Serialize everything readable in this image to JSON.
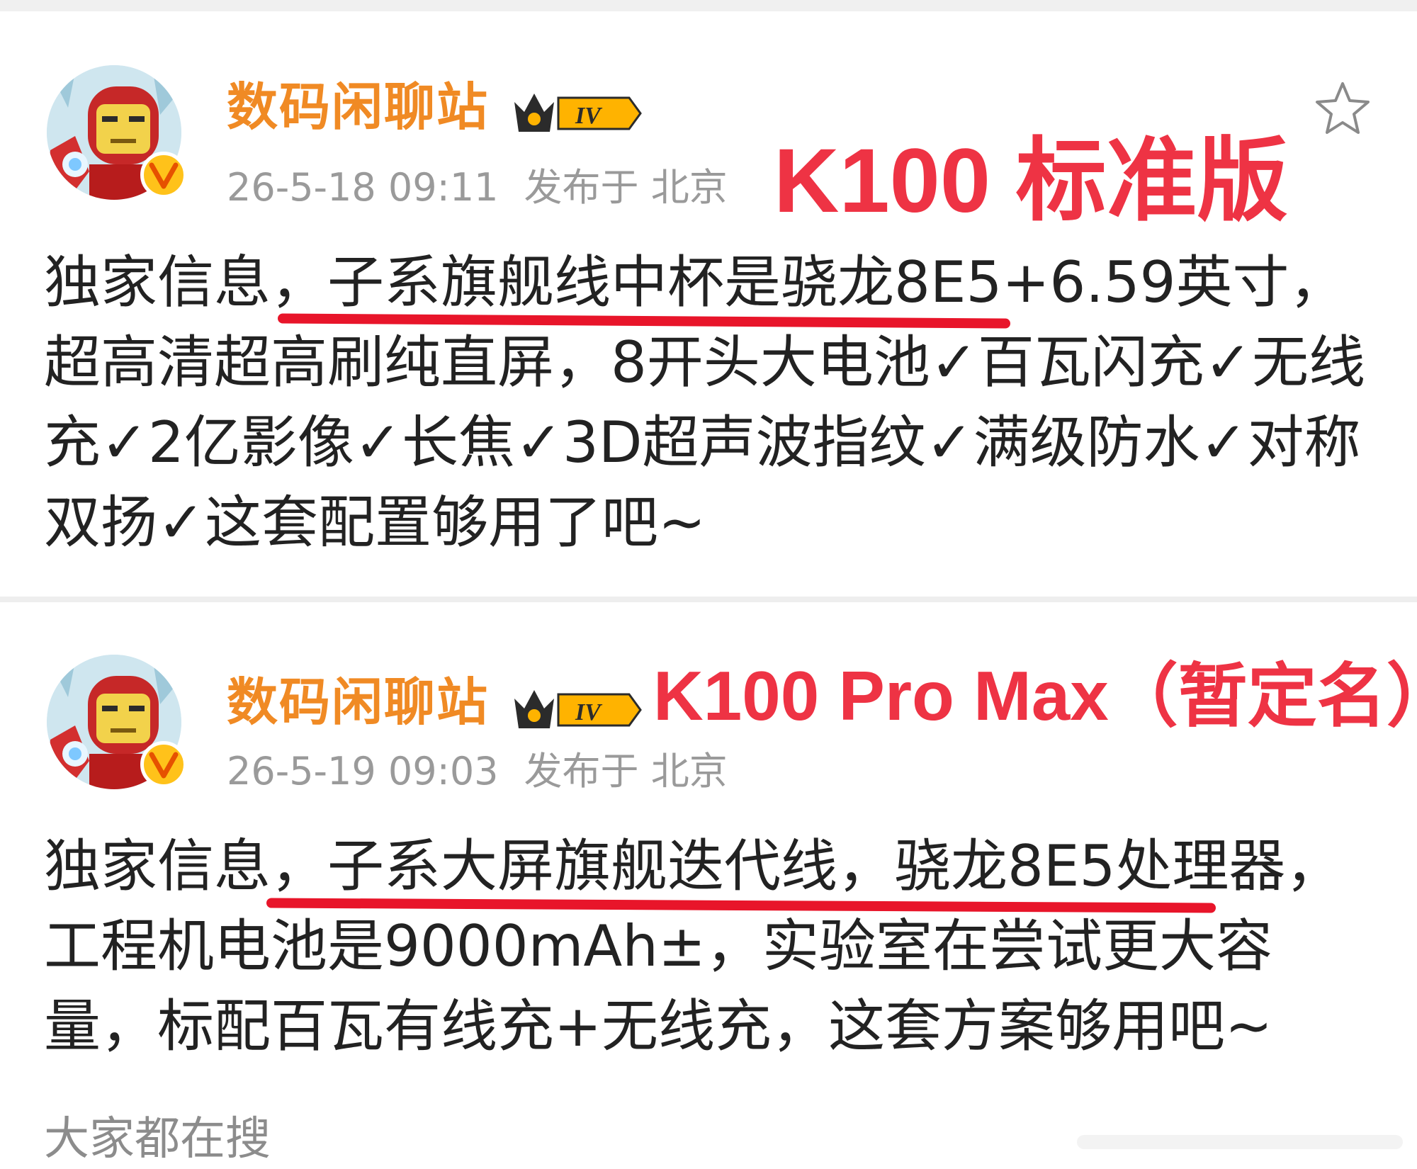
{
  "posts": [
    {
      "username": "数码闲聊站",
      "level_badge": "IV",
      "timestamp": "26-5-18 09:11",
      "location": "发布于 北京",
      "annotation": "K100 标准版",
      "content": "独家信息，子系旗舰线中杯是骁龙8E5+6.59英寸，超高清超高刷纯直屏，8开头大电池✓百瓦闪充✓无线充✓2亿影像✓长焦✓3D超声波指纹✓满级防水✓对称双扬✓这套配置够用了吧~",
      "highlighted_text": "子系旗舰线中杯是骁龙8E5+6.59"
    },
    {
      "username": "数码闲聊站",
      "level_badge": "IV",
      "timestamp": "26-5-19 09:03",
      "location": "发布于 北京",
      "annotation": "K100 Pro Max（暂定名）",
      "content": "独家信息，子系大屏旗舰迭代线，骁龙8E5处理器，工程机电池是9000mAh±，实验室在尝试更大容量，标配百瓦有线充+无线充，这套方案够用吧~",
      "highlighted_text": "子系大屏旗舰迭代线，骁龙8E5处理器，"
    }
  ],
  "footer": {
    "search_label": "大家都在搜"
  },
  "icons": {
    "favorite": "star-outline-icon",
    "verified": "verified-v-icon",
    "level": "crown-level-badge-icon"
  },
  "colors": {
    "username": "#f08a24",
    "meta": "#9a9a9a",
    "annotation": "#ee3344",
    "underline": "#e8152a",
    "verified_badge": "#ffc21a"
  }
}
